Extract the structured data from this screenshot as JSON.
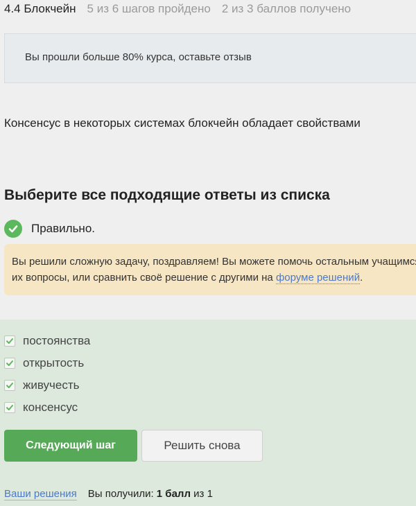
{
  "header": {
    "lesson_title": "4.4 Блокчейн",
    "steps_progress": "5 из 6 шагов пройдено",
    "points_progress": "2 из 3 баллов  получено"
  },
  "review_banner": {
    "text": "Вы прошли больше 80% курса, оставьте отзыв"
  },
  "question": {
    "text": "Консенсус в некоторых системах блокчейн обладает свойствами"
  },
  "instruction": {
    "text": "Выберите все подходящие ответы из списка"
  },
  "result": {
    "status_text": "Правильно.",
    "icon": "check-circle-icon",
    "color": "#5cb85c"
  },
  "hint": {
    "line1": "Вы решили сложную задачу, поздравляем! Вы можете помочь остальным учащимся в комментариях, отвечая на",
    "line2_prefix": "их вопросы, или сравнить своё решение с другими на ",
    "link_text": "форуме решений",
    "line2_suffix": "."
  },
  "options": [
    {
      "label": "постоянства",
      "checked": true
    },
    {
      "label": "открытость",
      "checked": true
    },
    {
      "label": "живучесть",
      "checked": true
    },
    {
      "label": "консенсус",
      "checked": true
    }
  ],
  "buttons": {
    "next_label": "Следующий шаг",
    "retry_label": "Решить снова"
  },
  "footer": {
    "solutions_link": "Ваши решения",
    "received_prefix": "Вы получили: ",
    "received_value": "1 балл",
    "received_suffix": " из 1"
  },
  "colors": {
    "accent_green": "#56a957",
    "answers_bg": "#dde9dc",
    "hint_bg": "#f7e6c4",
    "link": "#4d79c7"
  }
}
